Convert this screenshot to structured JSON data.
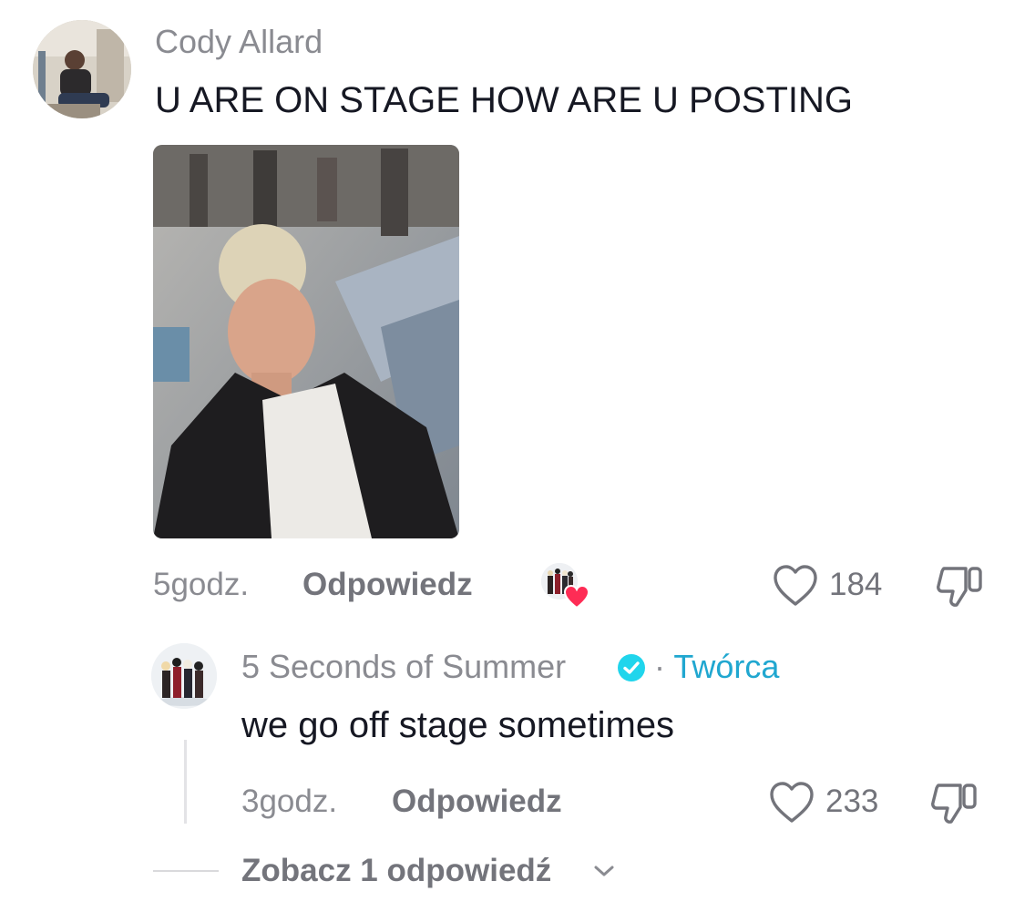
{
  "comment": {
    "username": "Cody Allard",
    "text": "U ARE ON STAGE HOW ARE U POSTING",
    "time": "5godz.",
    "reply_label": "Odpowiedz",
    "likes": "184",
    "has_attached_photo": true,
    "liked_by_creator": true
  },
  "reply": {
    "username": "5 Seconds of Summer",
    "verified": true,
    "separator": "·",
    "creator_label": "Twórca",
    "text": "we go off stage sometimes",
    "time": "3godz.",
    "reply_label": "Odpowiedz",
    "likes": "233"
  },
  "view_replies": {
    "label": "Zobacz 1 odpowiedź"
  },
  "icons": {
    "like": "heart-outline-icon",
    "dislike": "thumbs-down-icon",
    "verified": "verified-badge-icon",
    "creator_heart": "heart-filled-icon",
    "expand": "chevron-down-icon"
  },
  "colors": {
    "primary_text": "#161823",
    "secondary_text": "#8a8b91",
    "creator_accent": "#20a7d0",
    "verified_badge": "#20d5ec",
    "heart_red": "#fe2c55",
    "background": "#ffffff"
  }
}
